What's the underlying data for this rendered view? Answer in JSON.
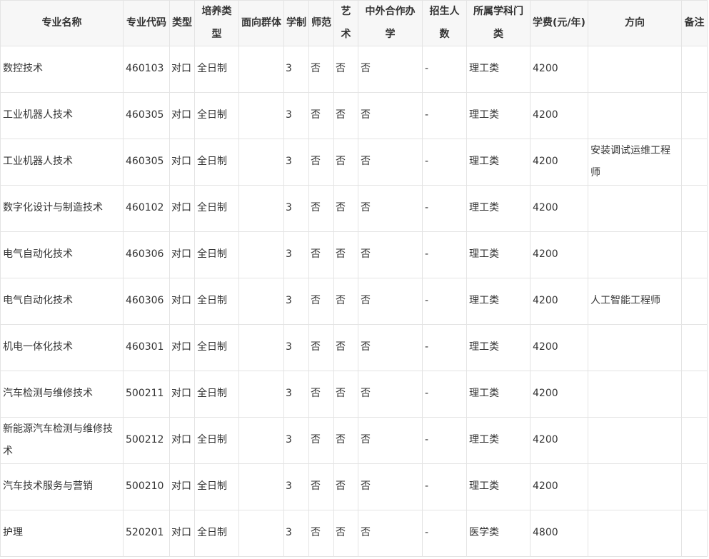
{
  "table": {
    "headers": [
      "专业名称",
      "专业代码",
      "类型",
      "培养类型",
      "面向群体",
      "学制",
      "师范",
      "艺术",
      "中外合作办学",
      "招生人数",
      "所属学科门类",
      "学费(元/年)",
      "方向",
      "备注"
    ],
    "rows": [
      [
        "数控技术",
        "460103",
        "对口",
        "全日制",
        "",
        "3",
        "否",
        "否",
        "否",
        "-",
        "理工类",
        "4200",
        "",
        ""
      ],
      [
        "工业机器人技术",
        "460305",
        "对口",
        "全日制",
        "",
        "3",
        "否",
        "否",
        "否",
        "-",
        "理工类",
        "4200",
        "",
        ""
      ],
      [
        "工业机器人技术",
        "460305",
        "对口",
        "全日制",
        "",
        "3",
        "否",
        "否",
        "否",
        "-",
        "理工类",
        "4200",
        "安装调试运维工程师",
        ""
      ],
      [
        "数字化设计与制造技术",
        "460102",
        "对口",
        "全日制",
        "",
        "3",
        "否",
        "否",
        "否",
        "-",
        "理工类",
        "4200",
        "",
        ""
      ],
      [
        "电气自动化技术",
        "460306",
        "对口",
        "全日制",
        "",
        "3",
        "否",
        "否",
        "否",
        "-",
        "理工类",
        "4200",
        "",
        ""
      ],
      [
        "电气自动化技术",
        "460306",
        "对口",
        "全日制",
        "",
        "3",
        "否",
        "否",
        "否",
        "-",
        "理工类",
        "4200",
        "人工智能工程师",
        ""
      ],
      [
        "机电一体化技术",
        "460301",
        "对口",
        "全日制",
        "",
        "3",
        "否",
        "否",
        "否",
        "-",
        "理工类",
        "4200",
        "",
        ""
      ],
      [
        "汽车检测与维修技术",
        "500211",
        "对口",
        "全日制",
        "",
        "3",
        "否",
        "否",
        "否",
        "-",
        "理工类",
        "4200",
        "",
        ""
      ],
      [
        "新能源汽车检测与维修技术",
        "500212",
        "对口",
        "全日制",
        "",
        "3",
        "否",
        "否",
        "否",
        "-",
        "理工类",
        "4200",
        "",
        ""
      ],
      [
        "汽车技术服务与营销",
        "500210",
        "对口",
        "全日制",
        "",
        "3",
        "否",
        "否",
        "否",
        "-",
        "理工类",
        "4200",
        "",
        ""
      ],
      [
        "护理",
        "520201",
        "对口",
        "全日制",
        "",
        "3",
        "否",
        "否",
        "否",
        "-",
        "医学类",
        "4800",
        "",
        ""
      ]
    ]
  }
}
